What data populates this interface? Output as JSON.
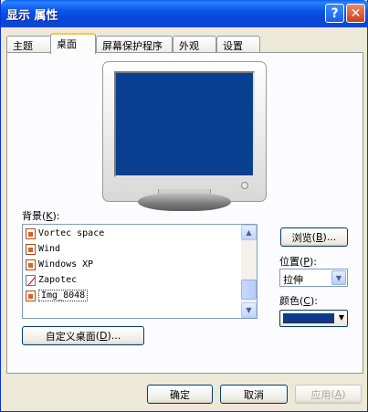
{
  "window": {
    "title": "显示 属性",
    "help_glyph": "?",
    "close_glyph": "✕"
  },
  "tabs": [
    {
      "label": "主题"
    },
    {
      "label": "桌面"
    },
    {
      "label": "屏幕保护程序"
    },
    {
      "label": "外观"
    },
    {
      "label": "设置"
    }
  ],
  "active_tab": "桌面",
  "background": {
    "label": "背景",
    "accel": "K",
    "items": [
      {
        "name": "Vortec space",
        "icon": "image-file-icon"
      },
      {
        "name": "Wind",
        "icon": "image-file-icon"
      },
      {
        "name": "Windows XP",
        "icon": "image-file-icon"
      },
      {
        "name": "Zapotec",
        "icon": "no-image-icon"
      },
      {
        "name": "Img_8048",
        "icon": "image-file-icon",
        "selected": true
      }
    ]
  },
  "browse_button": {
    "label": "浏览",
    "accel": "B",
    "suffix": "..."
  },
  "position": {
    "label": "位置",
    "accel": "P",
    "value": "拉伸"
  },
  "color": {
    "label": "颜色",
    "accel": "C",
    "value": "#0a3a8c"
  },
  "customize_button": {
    "label": "自定义桌面",
    "accel": "D",
    "suffix": "..."
  },
  "footer": {
    "ok": "确定",
    "cancel": "取消",
    "apply": "应用",
    "apply_accel": "A"
  },
  "colors": {
    "titlebar": "#0a55e8",
    "desktop_preview": "#0a3f92",
    "active_tab_accent": "#ffc83c"
  }
}
